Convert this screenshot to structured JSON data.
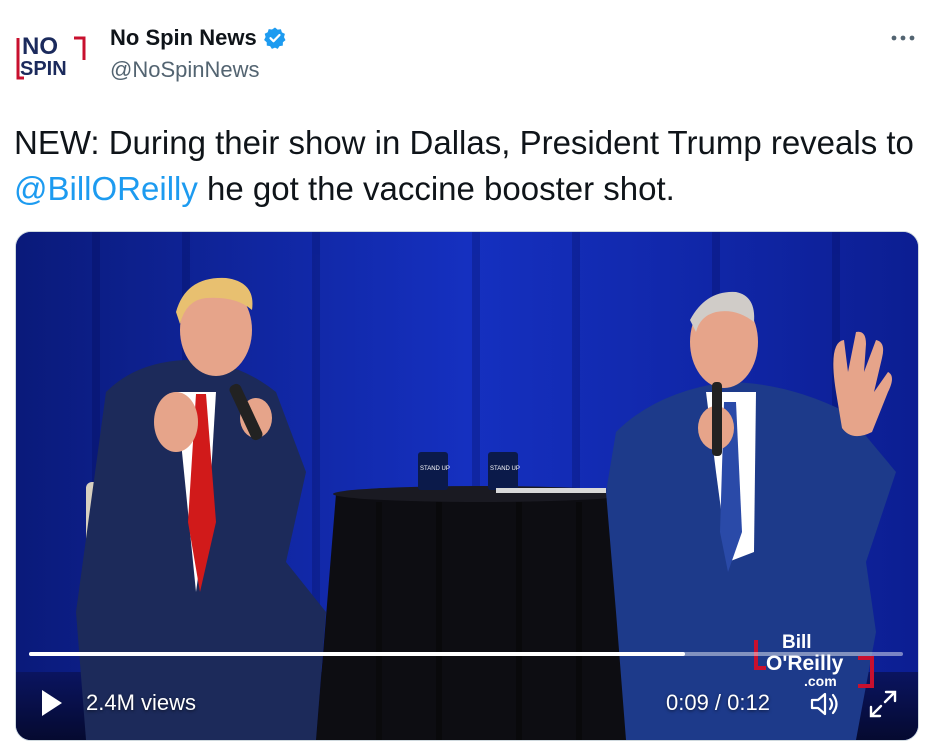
{
  "author": {
    "name": "No Spin News",
    "handle": "@NoSpinNews",
    "avatar_text_top": "NO",
    "avatar_text_bottom": "SPIN"
  },
  "icons": {
    "verified": "verified-badge-icon",
    "more": "more-dots-icon",
    "play": "play-icon",
    "volume": "volume-icon",
    "fullscreen": "fullscreen-icon"
  },
  "tweet": {
    "text_before": "NEW: During their show in Dallas, President Trump reveals to ",
    "mention": "@BillOReilly",
    "text_after": " he got the vaccine booster shot."
  },
  "video": {
    "views": "2.4M views",
    "time": "0:09 / 0:12",
    "progress": 0.75,
    "watermark_line1": "Bill",
    "watermark_line2": "O'Reilly",
    "watermark_line3": ".com",
    "mug_text": "STAND UP"
  },
  "colors": {
    "accent": "#1d9bf0",
    "stage_blue": "#0b1f8c",
    "avatar_red": "#c8102e",
    "avatar_navy": "#1b2a5c"
  }
}
